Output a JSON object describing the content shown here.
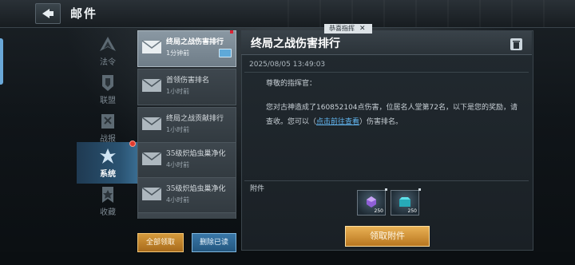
{
  "header": {
    "title": "邮件"
  },
  "categories": [
    {
      "label": "法令",
      "icon": "decree-icon",
      "active": false
    },
    {
      "label": "联盟",
      "icon": "alliance-icon",
      "active": false
    },
    {
      "label": "战报",
      "icon": "battle-report-icon",
      "active": false
    },
    {
      "label": "系统",
      "icon": "system-icon",
      "active": true,
      "badge": true
    },
    {
      "label": "收藏",
      "icon": "favorite-icon",
      "active": false
    }
  ],
  "mails": [
    {
      "subject": "终局之战伤害排行",
      "time": "1分钟前",
      "active": true,
      "attachment": true
    },
    {
      "subject": "首领伤害排名",
      "time": "1小时前"
    },
    {
      "subject": "终局之战贡献排行",
      "time": "1小时前"
    },
    {
      "subject": "35级炽焰虫巢净化",
      "time": "4小时前"
    },
    {
      "subject": "35级炽焰虫巢净化",
      "time": "4小时前"
    }
  ],
  "buttons": {
    "collect_all": "全部领取",
    "delete_read": "删除已读",
    "claim": "领取附件"
  },
  "detail": {
    "tab_label": "恭喜指挥",
    "title": "终局之战伤害排行",
    "datetime": "2025/08/05  13:49:03",
    "greeting": "尊敬的指挥官：",
    "body_before": "您对古神造成了160852104点伤害，位居名人堂第72名，以下是您的奖励，请查收。您可以（",
    "link_text": "点击前往查看",
    "body_after": "）伤害排名。",
    "attachments_label": "附件",
    "attachments": [
      {
        "icon": "purple-crystal-icon",
        "qty": "250"
      },
      {
        "icon": "cyan-chest-icon",
        "qty": "250"
      }
    ]
  },
  "colors": {
    "accent_blue": "#2a5372",
    "gold": "#d59a3c",
    "link": "#62b6f0"
  }
}
